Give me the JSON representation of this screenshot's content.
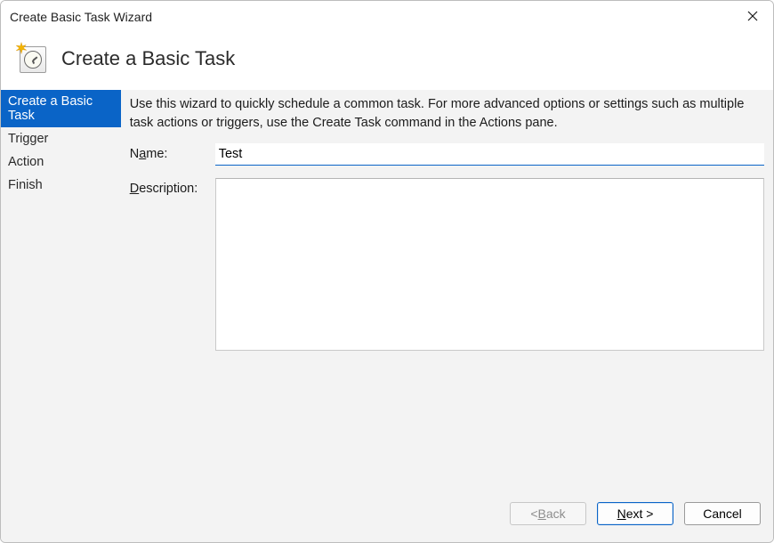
{
  "window": {
    "title": "Create Basic Task Wizard"
  },
  "header": {
    "heading": "Create a Basic Task"
  },
  "sidebar": {
    "steps": [
      {
        "label": "Create a Basic Task",
        "active": true
      },
      {
        "label": "Trigger",
        "active": false
      },
      {
        "label": "Action",
        "active": false
      },
      {
        "label": "Finish",
        "active": false
      }
    ]
  },
  "content": {
    "intro": "Use this wizard to quickly schedule a common task.  For more advanced options or settings such as multiple task actions or triggers, use the Create Task command in the Actions pane.",
    "name_label_pre": "N",
    "name_label_ul": "a",
    "name_label_post": "me:",
    "name_value": "Test",
    "desc_label_ul": "D",
    "desc_label_post": "escription:",
    "desc_value": ""
  },
  "footer": {
    "back_pre": "< ",
    "back_ul": "B",
    "back_post": "ack",
    "next_ul": "N",
    "next_post": "ext >",
    "cancel": "Cancel"
  }
}
